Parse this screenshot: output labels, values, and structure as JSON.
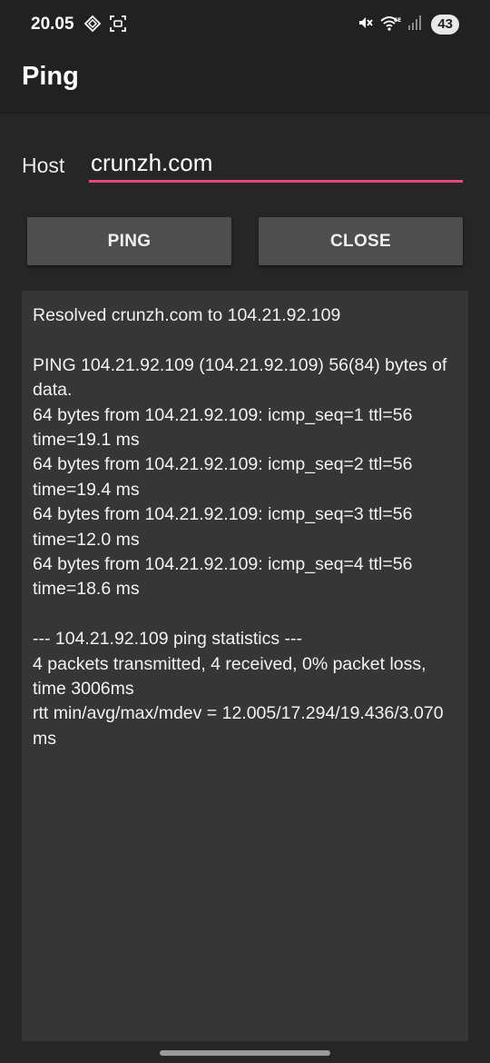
{
  "status_bar": {
    "time": "20.05",
    "battery": "43",
    "icons": [
      "location-diamond-icon",
      "screenshot-icon",
      "muted-vibrate-icon",
      "wifi-6e-icon",
      "signal-icon"
    ]
  },
  "app_bar": {
    "title": "Ping"
  },
  "host": {
    "label": "Host",
    "value": "crunzh.com",
    "underline_color": "#e8457c"
  },
  "buttons": {
    "ping_label": "PING",
    "close_label": "CLOSE"
  },
  "output": {
    "lines": [
      "Resolved crunzh.com to 104.21.92.109",
      "",
      "PING 104.21.92.109 (104.21.92.109) 56(84) bytes of data.",
      "64 bytes from 104.21.92.109: icmp_seq=1 ttl=56 time=19.1 ms",
      "64 bytes from 104.21.92.109: icmp_seq=2 ttl=56 time=19.4 ms",
      "64 bytes from 104.21.92.109: icmp_seq=3 ttl=56 time=12.0 ms",
      "64 bytes from 104.21.92.109: icmp_seq=4 ttl=56 time=18.6 ms",
      "",
      "--- 104.21.92.109 ping statistics ---",
      "4 packets transmitted, 4 received, 0% packet loss, time 3006ms",
      "rtt min/avg/max/mdev = 12.005/17.294/19.436/3.070 ms"
    ]
  }
}
